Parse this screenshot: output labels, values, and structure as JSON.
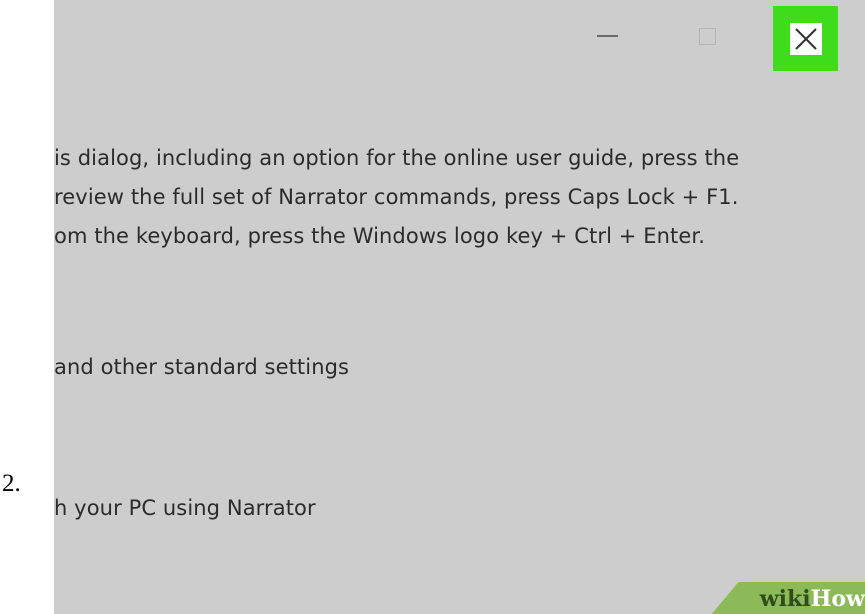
{
  "step": {
    "number": "2."
  },
  "window": {
    "controls": {
      "minimize_icon": "minimize-icon",
      "maximize_icon": "maximize-icon",
      "close_icon": "close-icon",
      "close_highlight_color": "#3fdc1c"
    }
  },
  "content": {
    "line1": "is dialog, including an option for the online user guide, press the",
    "line2": "review the full set of Narrator commands, press Caps Lock + F1.",
    "line3": "om the keyboard, press the Windows logo key + Ctrl + Enter.",
    "line4": "and other standard settings",
    "line5": "h your PC using Narrator"
  },
  "watermark": {
    "part1": "wiki",
    "part2": "How",
    "color": "#8cba59"
  }
}
